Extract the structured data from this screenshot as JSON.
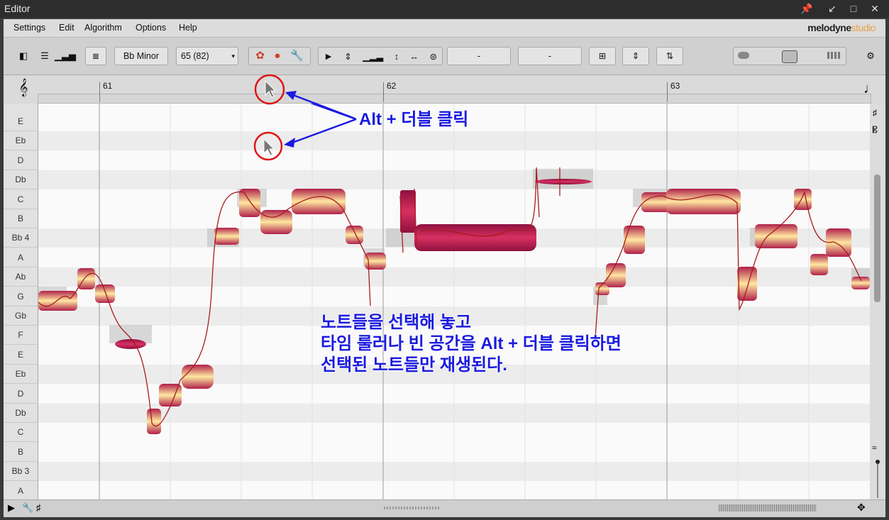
{
  "window": {
    "title": "Editor"
  },
  "menu": {
    "items": [
      "Settings",
      "Edit",
      "Algorithm",
      "Options",
      "Help"
    ]
  },
  "brand": {
    "name": "melodyne",
    "edition": "studio"
  },
  "toolbar": {
    "scale_label": "Bb Minor",
    "tempo_value": "65 (82)",
    "field1_value": "-",
    "field2_value": "-"
  },
  "ruler": {
    "bars": [
      "61",
      "62",
      "63"
    ]
  },
  "keys": [
    "E",
    "Eb",
    "D",
    "Db",
    "C",
    "B",
    "Bb 4",
    "A",
    "Ab",
    "G",
    "Gb",
    "F",
    "E",
    "Eb",
    "D",
    "Db",
    "C",
    "B",
    "Bb 3",
    "A"
  ],
  "annotations": {
    "arrow_text": "Alt + 더블 클릭",
    "instructions": [
      "노트들을 선택해 놓고",
      "타임 룰러나 빈 공간을 Alt + 더블 클릭하면",
      "선택된 노트들만 재생된다."
    ]
  },
  "icons": {
    "window_buttons": [
      "pin-icon",
      "undock-icon",
      "maximize-icon",
      "close-icon"
    ],
    "tools": [
      "main-tool-icon",
      "pitch-tool-icon",
      "formant-tool-icon",
      "amplitude-tool-icon",
      "timing-tool-icon",
      "time-handle-tool-icon",
      "note-separation-tool-icon"
    ]
  },
  "colors": {
    "accent": "#1a1ae0",
    "note_dark": "#b0204a",
    "note_light": "#fff1b8",
    "highlight_circle": "#e01515"
  }
}
